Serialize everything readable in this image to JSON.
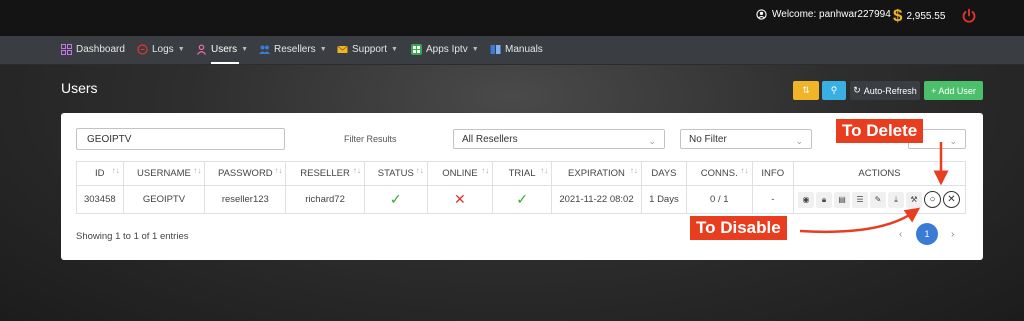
{
  "header": {
    "welcome": "Welcome: panhwar227994",
    "balance": "2,955.55",
    "currency_symbol": "$"
  },
  "nav": {
    "items": [
      {
        "label": "Dashboard",
        "icon": "dashboard-icon"
      },
      {
        "label": "Logs",
        "icon": "logs-icon",
        "dropdown": true
      },
      {
        "label": "Users",
        "icon": "user-icon",
        "dropdown": true,
        "active": true
      },
      {
        "label": "Resellers",
        "icon": "resellers-icon",
        "dropdown": true
      },
      {
        "label": "Support",
        "icon": "envelope-icon",
        "dropdown": true
      },
      {
        "label": "Apps Iptv",
        "icon": "apps-icon",
        "dropdown": true
      },
      {
        "label": "Manuals",
        "icon": "book-icon"
      }
    ]
  },
  "page": {
    "title": "Users",
    "toolbar": {
      "auto_refresh_label": "Auto-Refresh",
      "add_user_label": "+ Add User"
    }
  },
  "filters": {
    "search_value": "GEOIPTV",
    "filter_results_label": "Filter Results",
    "reseller_select": "All Resellers",
    "status_select": "No Filter"
  },
  "table": {
    "columns": [
      "ID",
      "USERNAME",
      "PASSWORD",
      "RESELLER",
      "STATUS",
      "ONLINE",
      "TRIAL",
      "EXPIRATION",
      "DAYS",
      "CONNS.",
      "INFO",
      "ACTIONS"
    ],
    "rows": [
      {
        "id": "303458",
        "username": "GEOIPTV",
        "password": "reseller123",
        "reseller": "richard72",
        "status": "check",
        "online": "cross",
        "trial": "check",
        "expiration": "2021-11-22 08:02",
        "days": "1 Days",
        "conns": "0 / 1",
        "info": "-"
      }
    ]
  },
  "footer": {
    "showing": "Showing 1 to 1 of 1 entries",
    "current_page": "1"
  },
  "annotations": {
    "delete_label": "To Delete",
    "disable_label": "To Disable"
  },
  "colors": {
    "accent_blue": "#3a7bd5",
    "add_green": "#4cbf6b",
    "callout_red": "#e83d1f",
    "yellow_btn": "#f0b429",
    "cyan_btn": "#3ab0e2"
  }
}
